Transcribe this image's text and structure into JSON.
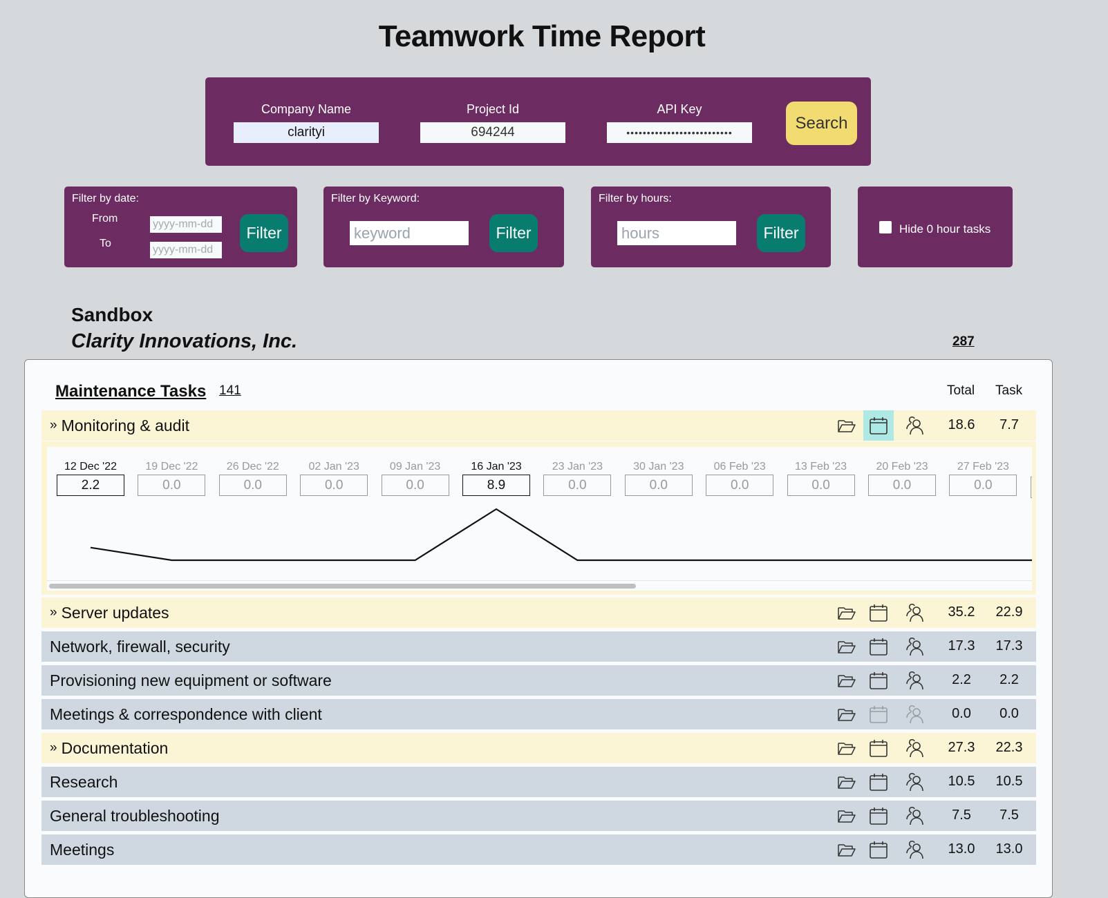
{
  "page": {
    "title": "Teamwork Time Report"
  },
  "search": {
    "company_label": "Company Name",
    "company_value": "clarityi",
    "project_label": "Project Id",
    "project_value": "694244",
    "api_label": "API Key",
    "api_value": "••••••••••••••••••••••••••",
    "search_label": "Search"
  },
  "filters": {
    "date": {
      "label": "Filter by date:",
      "from_label": "From",
      "to_label": "To",
      "from_placeholder": "yyyy-mm-dd",
      "to_placeholder": "yyyy-mm-dd",
      "button": "Filter"
    },
    "keyword": {
      "label": "Filter by Keyword:",
      "placeholder": "keyword",
      "button": "Filter"
    },
    "hours": {
      "label": "Filter by hours:",
      "placeholder": "hours",
      "button": "Filter"
    },
    "hide_zero": {
      "label": "Hide 0 hour tasks",
      "checked": false
    }
  },
  "report": {
    "org": "Sandbox",
    "company": "Clarity Innovations, Inc.",
    "grand_total": "287"
  },
  "category": {
    "title": "Maintenance Tasks",
    "count": "141",
    "col_total": "Total",
    "col_task": "Task",
    "rows": [
      {
        "name": "Monitoring & audit",
        "parent": true,
        "total": "18.6",
        "task": "7.7"
      },
      {
        "name": "Server updates",
        "parent": true,
        "total": "35.2",
        "task": "22.9"
      },
      {
        "name": "Network, firewall, security",
        "parent": false,
        "total": "17.3",
        "task": "17.3"
      },
      {
        "name": "Provisioning new equipment or software",
        "parent": false,
        "total": "2.2",
        "task": "2.2"
      },
      {
        "name": "Meetings & correspondence with client",
        "parent": false,
        "total": "0.0",
        "task": "0.0"
      },
      {
        "name": "Documentation",
        "parent": true,
        "total": "27.3",
        "task": "22.3"
      },
      {
        "name": "Research",
        "parent": false,
        "total": "10.5",
        "task": "10.5"
      },
      {
        "name": "General troubleshooting",
        "parent": false,
        "total": "7.5",
        "task": "7.5"
      },
      {
        "name": "Meetings",
        "parent": false,
        "total": "13.0",
        "task": "13.0"
      }
    ],
    "chevron": "»"
  },
  "timeline": {
    "task": "Monitoring & audit",
    "weeks": [
      {
        "date": "12 Dec '22",
        "hours": "2.2"
      },
      {
        "date": "19 Dec '22",
        "hours": "0.0"
      },
      {
        "date": "26 Dec '22",
        "hours": "0.0"
      },
      {
        "date": "02 Jan '23",
        "hours": "0.0"
      },
      {
        "date": "09 Jan '23",
        "hours": "0.0"
      },
      {
        "date": "16 Jan '23",
        "hours": "8.9"
      },
      {
        "date": "23 Jan '23",
        "hours": "0.0"
      },
      {
        "date": "30 Jan '23",
        "hours": "0.0"
      },
      {
        "date": "06 Feb '23",
        "hours": "0.0"
      },
      {
        "date": "13 Feb '23",
        "hours": "0.0"
      },
      {
        "date": "20 Feb '23",
        "hours": "0.0"
      },
      {
        "date": "27 Feb '23",
        "hours": "0.0"
      }
    ],
    "scroll_fraction": 0.6
  },
  "colors": {
    "panel": "#6d2c61",
    "filter_button": "#087c6f",
    "search_button": "#f2dc72",
    "parent_row": "#fbf4d5",
    "leaf_row": "#cfd8e0",
    "calendar_highlight": "#aee9e6"
  }
}
